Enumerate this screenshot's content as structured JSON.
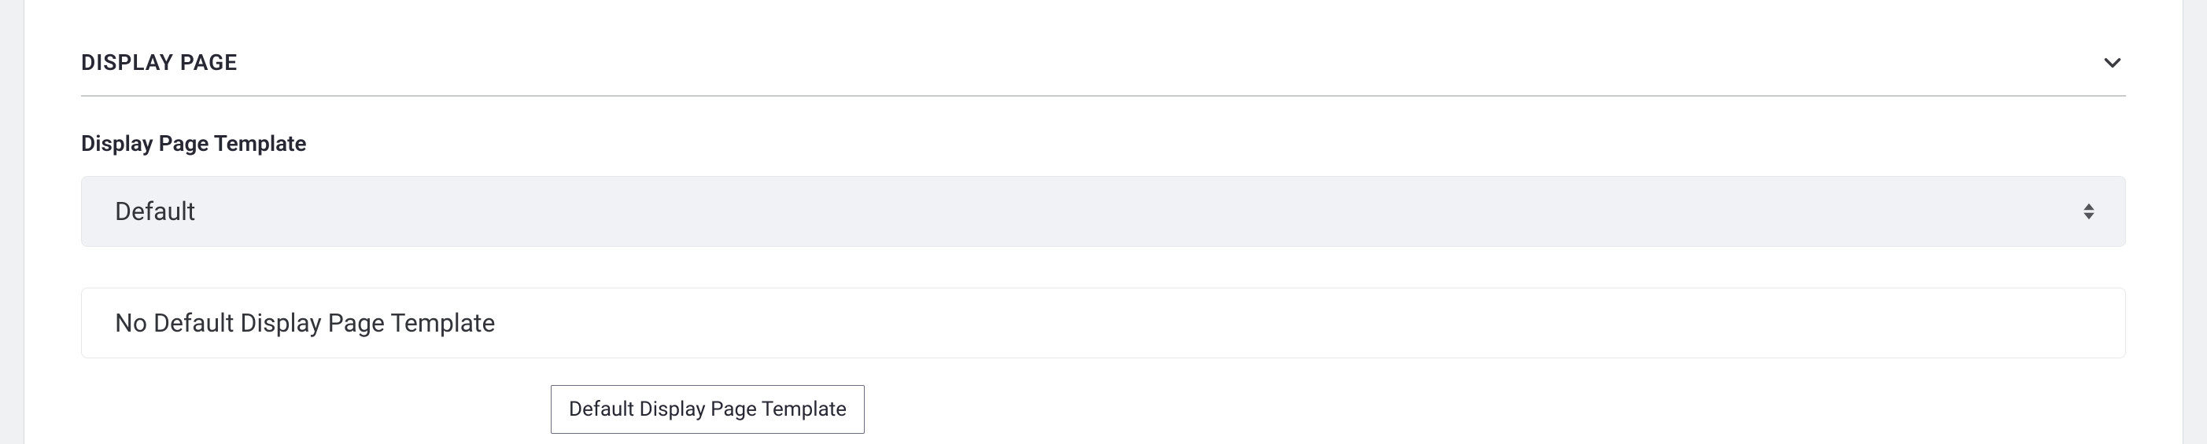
{
  "section": {
    "title": "DISPLAY PAGE"
  },
  "displayPage": {
    "label": "Display Page Template",
    "selected": "Default",
    "info": "No Default Display Page Template",
    "tooltip": "Default Display Page Template"
  }
}
